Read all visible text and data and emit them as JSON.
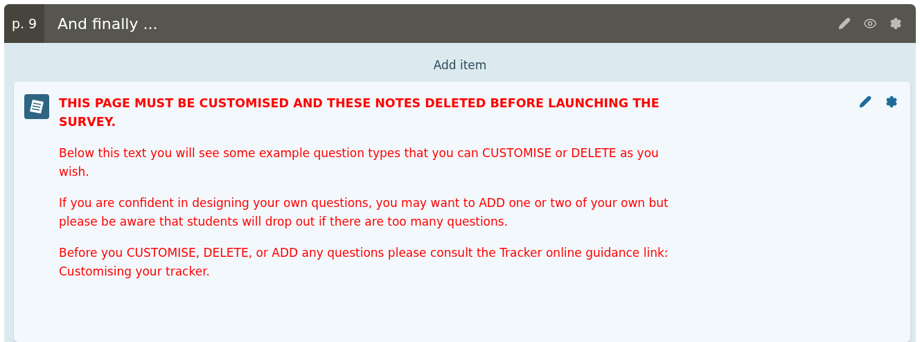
{
  "page": {
    "number": "p. 9",
    "title": "And finally ..."
  },
  "add_item": "Add item",
  "note": {
    "heading": "THIS PAGE MUST BE CUSTOMISED AND THESE NOTES DELETED BEFORE LAUNCHING THE SURVEY.",
    "paragraphs": [
      "Below this text you will see some example question types that you can CUSTOMISE or DELETE as you wish.",
      "If you are confident in designing your own questions, you may want to ADD one or two of your own but please be aware that students will drop out if there are too many questions.",
      "Before you CUSTOMISE, DELETE, or ADD any questions please consult the Tracker online guidance link: Customising your tracker."
    ]
  }
}
